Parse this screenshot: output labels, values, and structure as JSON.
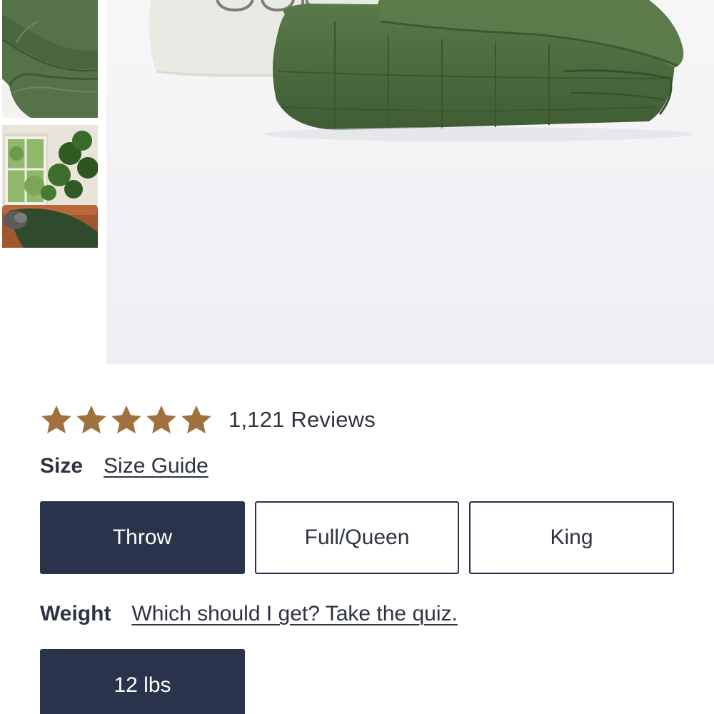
{
  "gallery": {
    "thumbnails": [
      {
        "alt": "green blanket detail",
        "selected": false
      },
      {
        "alt": "green blanket on couch in living room",
        "selected": false
      }
    ],
    "hero": {
      "alt": "folded green weighted blanket with pillow"
    },
    "colors": {
      "blanket_green": "#4d6b3f",
      "background": "#f3f3f7"
    }
  },
  "rating": {
    "stars_value": 5,
    "stars_max": 5,
    "star_color": "#a0703e",
    "reviews_label": "1,121 Reviews"
  },
  "size": {
    "label": "Size",
    "guide_link": "Size Guide",
    "options": [
      {
        "label": "Throw",
        "selected": true
      },
      {
        "label": "Full/Queen",
        "selected": false
      },
      {
        "label": "King",
        "selected": false
      }
    ]
  },
  "weight": {
    "label": "Weight",
    "quiz_link": "Which should I get? Take the quiz.",
    "options": [
      {
        "label": "12 lbs",
        "selected": true
      }
    ]
  },
  "theme": {
    "accent_navy": "#2a334c",
    "text_color": "#2d3340"
  }
}
